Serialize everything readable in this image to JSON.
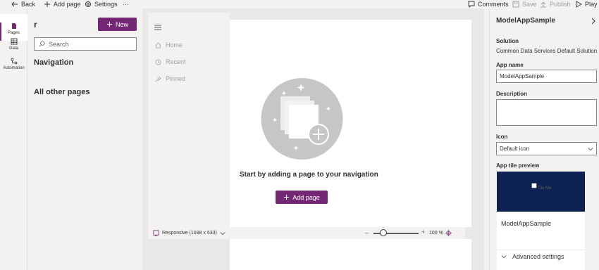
{
  "topbar": {
    "back": "Back",
    "add_page": "Add page",
    "settings": "Settings",
    "more": "···",
    "comments": "Comments",
    "save": "Save",
    "publish": "Publish",
    "play": "Play"
  },
  "rail": {
    "pages": "Pages",
    "data": "Data",
    "automation": "Automation"
  },
  "pages_pane": {
    "title": "r",
    "new_label": "New",
    "search_placeholder": "Search",
    "navigation_heading": "Navigation",
    "other_heading": "All other pages"
  },
  "preview": {
    "nav_items": [
      "Home",
      "Recent",
      "Pinned"
    ],
    "empty_message": "Start by adding a page to your navigation",
    "add_page_label": "Add page"
  },
  "statusbar": {
    "device": "Responsive (1038 x 633)",
    "zoom": "100 %"
  },
  "properties": {
    "title": "ModelAppSample",
    "solution_label": "Solution",
    "solution_value": "Common Data Services Default Solution",
    "app_name_label": "App name",
    "app_name_value": "ModelAppSample",
    "description_label": "Description",
    "description_value": "",
    "icon_label": "Icon",
    "icon_value": "Default icon",
    "tile_preview_label": "App tile preview",
    "tile_image_alt": "Tile Me",
    "tile_app_name": "ModelAppSample",
    "advanced_settings": "Advanced settings"
  },
  "colors": {
    "accent": "#742774",
    "tile_header": "#0d2253"
  }
}
